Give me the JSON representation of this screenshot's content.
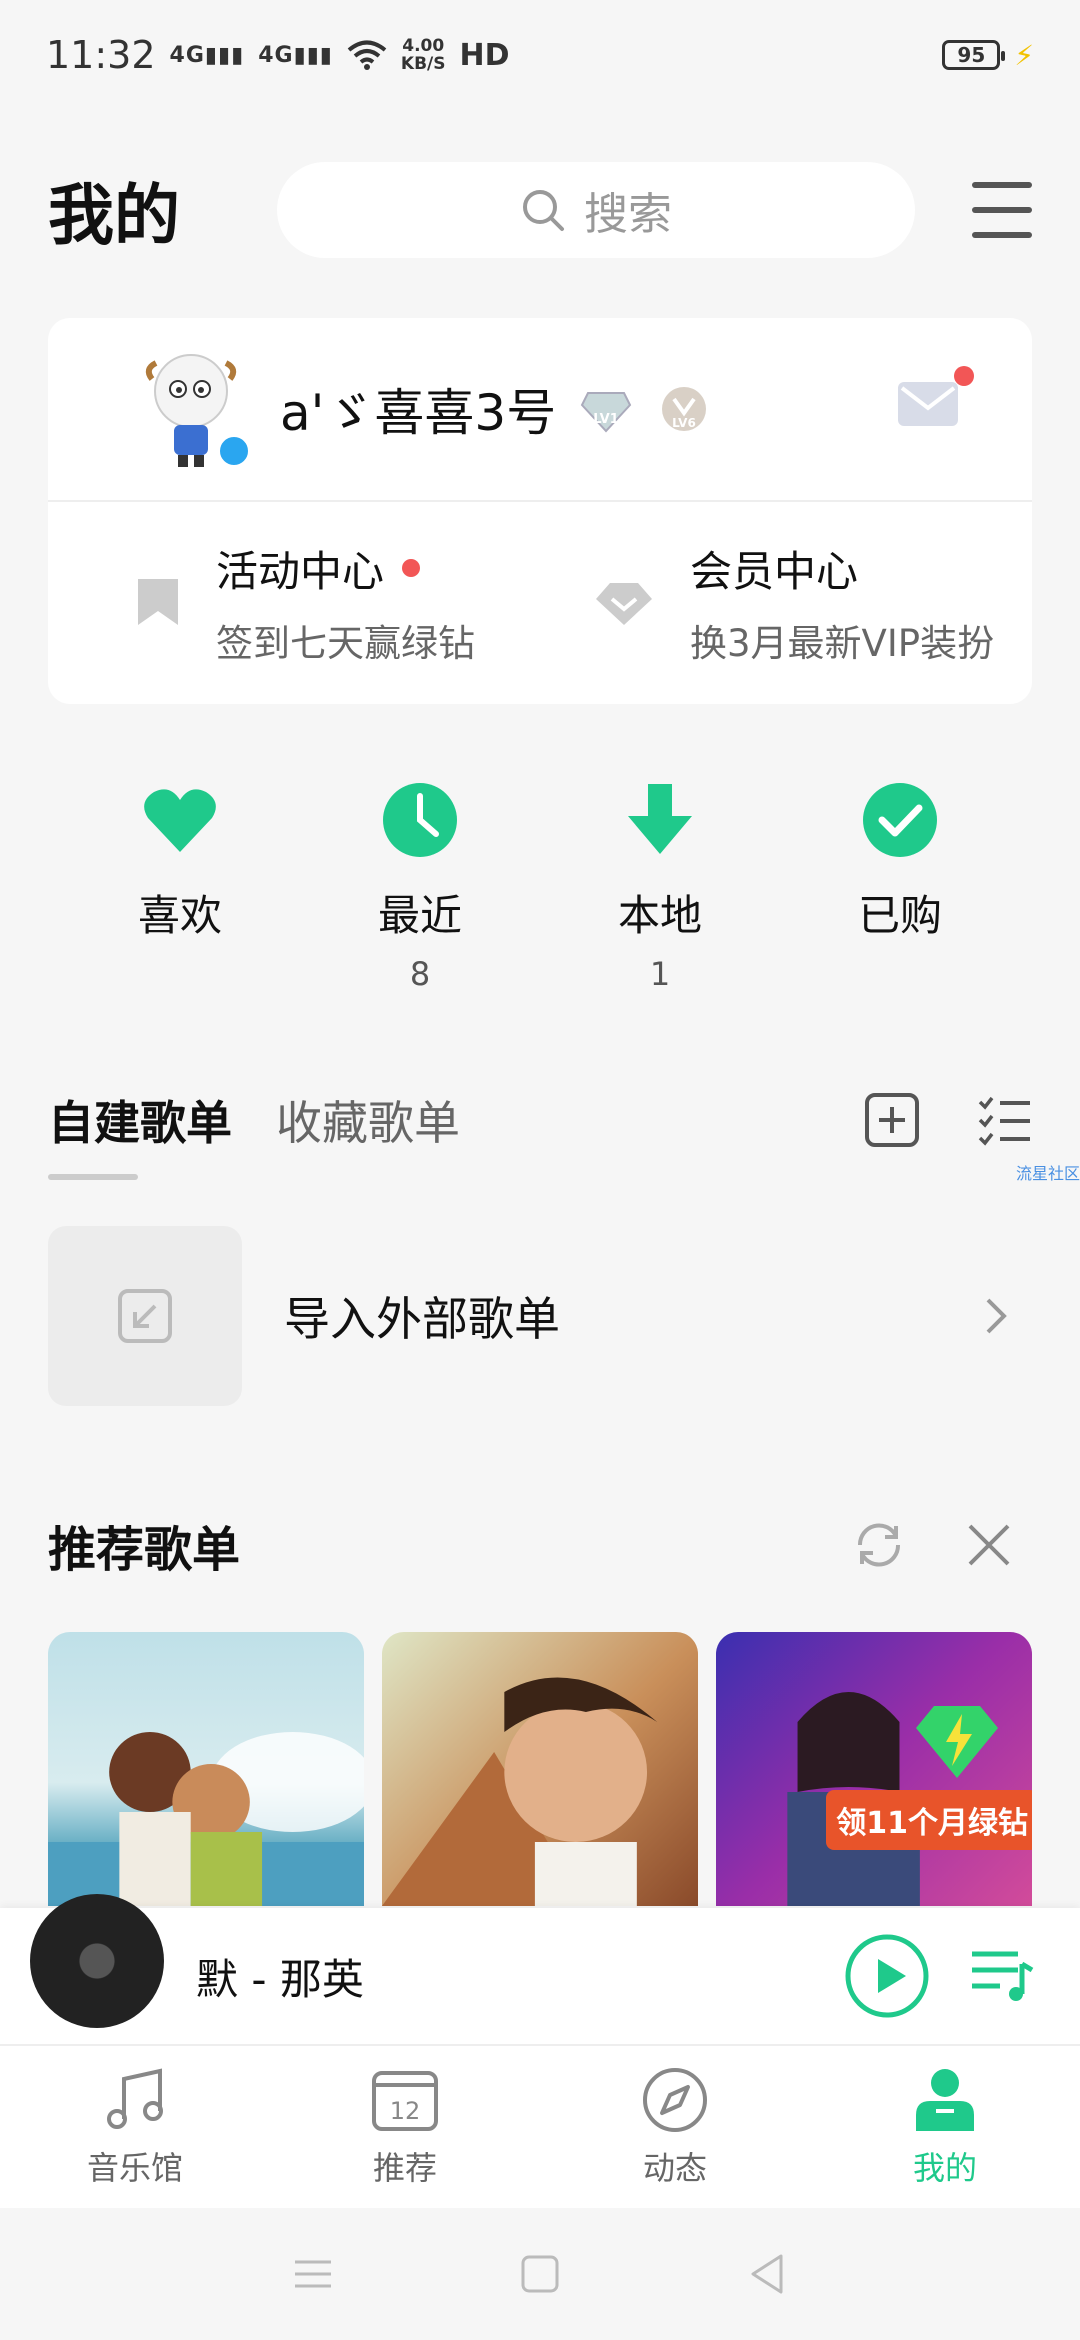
{
  "status_bar": {
    "time": "11:32",
    "signal1": "4G",
    "signal2": "4G",
    "speed_value": "4.00",
    "speed_unit": "KB/S",
    "hd": "HD",
    "battery": "95"
  },
  "header": {
    "title": "我的",
    "search_placeholder": "搜索"
  },
  "profile": {
    "username": "a'ゞ喜喜3号",
    "level1": "LV1",
    "level2": "LV6"
  },
  "centers": [
    {
      "title": "活动中心",
      "subtitle": "签到七天赢绿钻"
    },
    {
      "title": "会员中心",
      "subtitle": "换3月最新VIP装扮"
    }
  ],
  "quick_actions": [
    {
      "label": "喜欢",
      "count": ""
    },
    {
      "label": "最近",
      "count": "8"
    },
    {
      "label": "本地",
      "count": "1"
    },
    {
      "label": "已购",
      "count": ""
    }
  ],
  "playlists": {
    "tabs": [
      "自建歌单",
      "收藏歌单"
    ],
    "import_label": "导入外部歌单"
  },
  "watermark": "流星社区",
  "recommended": {
    "title": "推荐歌单",
    "promo_text": "领11个月绿钻"
  },
  "player": {
    "song": "默 - 那英"
  },
  "bottom_nav": [
    {
      "label": "音乐馆"
    },
    {
      "label": "推荐",
      "icon_text": "12"
    },
    {
      "label": "动态"
    },
    {
      "label": "我的"
    }
  ],
  "colors": {
    "accent": "#1fc98b",
    "notification": "#f25656",
    "background": "#f6f6f6"
  }
}
